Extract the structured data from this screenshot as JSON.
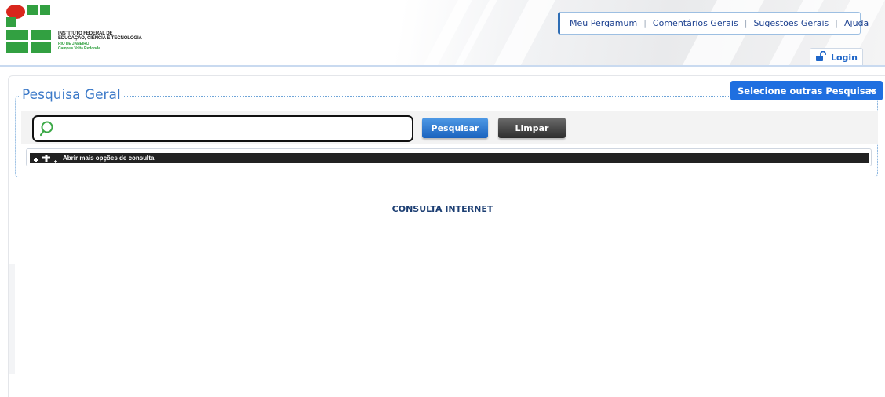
{
  "header": {
    "logo": {
      "name": "logo-ifrj",
      "line1": "INSTITUTO FEDERAL DE",
      "line2": "EDUCAÇÃO, CIÊNCIA E TECNOLOGIA",
      "line3": "RIO DE JANEIRO",
      "line4": "Campus Volta Redonda"
    },
    "links": [
      {
        "label": "Meu Pergamum"
      },
      {
        "label": "Comentários Gerais"
      },
      {
        "label": "Sugestões Gerais"
      },
      {
        "label": "Ajuda"
      }
    ],
    "separator": "|",
    "login": {
      "label": "Login",
      "icon": "unlock-icon"
    }
  },
  "search": {
    "title": "Pesquisa Geral",
    "other_searches_label": "Selecione outras Pesquisas",
    "input_value": "",
    "search_button": "Pesquisar",
    "clear_button": "Limpar",
    "more_options": "Abrir mais opções de consulta"
  },
  "footer_label": "CONSULTA INTERNET",
  "colors": {
    "accent_blue": "#1f6fe0",
    "link_blue": "#1a3f8f",
    "title_blue": "#3b79c8",
    "logo_green": "#32a041",
    "logo_red": "#d9261c"
  }
}
